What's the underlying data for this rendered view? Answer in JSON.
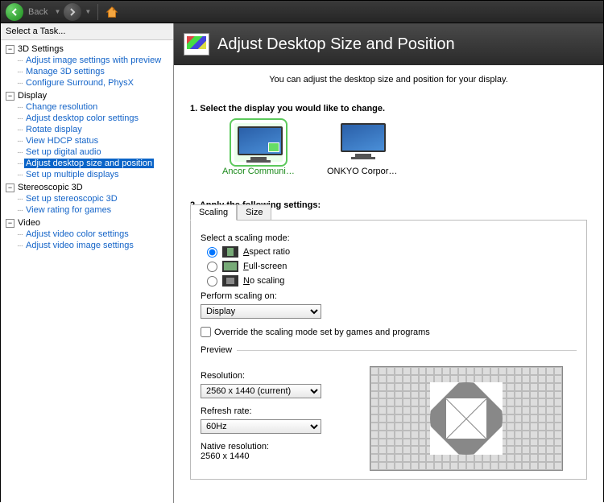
{
  "toolbar": {
    "back_label": "Back"
  },
  "sidebar": {
    "header": "Select a Task...",
    "groups": [
      {
        "label": "3D Settings",
        "items": [
          "Adjust image settings with preview",
          "Manage 3D settings",
          "Configure Surround, PhysX"
        ]
      },
      {
        "label": "Display",
        "items": [
          "Change resolution",
          "Adjust desktop color settings",
          "Rotate display",
          "View HDCP status",
          "Set up digital audio",
          "Adjust desktop size and position",
          "Set up multiple displays"
        ],
        "selected": 5
      },
      {
        "label": "Stereoscopic 3D",
        "items": [
          "Set up stereoscopic 3D",
          "View rating for games"
        ]
      },
      {
        "label": "Video",
        "items": [
          "Adjust video color settings",
          "Adjust video image settings"
        ]
      }
    ]
  },
  "page": {
    "title": "Adjust Desktop Size and Position",
    "intro": "You can adjust the desktop size and position for your display.",
    "step1": "1. Select the display you would like to change.",
    "displays": [
      {
        "label": "Ancor Communic...",
        "selected": true
      },
      {
        "label": "ONKYO Corporatio...",
        "selected": false
      }
    ],
    "step2": "2. Apply the following settings:",
    "tabs": [
      "Scaling",
      "Size"
    ],
    "scaling": {
      "mode_label": "Select a scaling mode:",
      "modes": [
        {
          "label": "Aspect ratio",
          "u": "A"
        },
        {
          "label": "Full-screen",
          "u": "F"
        },
        {
          "label": "No scaling",
          "u": "N"
        }
      ],
      "perform_label": "Perform scaling on:",
      "perform_value": "Display",
      "override": "Override the scaling mode set by games and programs",
      "preview_label": "Preview",
      "resolution_label": "Resolution:",
      "resolution_value": "2560 x 1440 (current)",
      "refresh_label": "Refresh rate:",
      "refresh_value": "60Hz",
      "native_label": "Native resolution:",
      "native_value": "2560 x 1440"
    }
  }
}
